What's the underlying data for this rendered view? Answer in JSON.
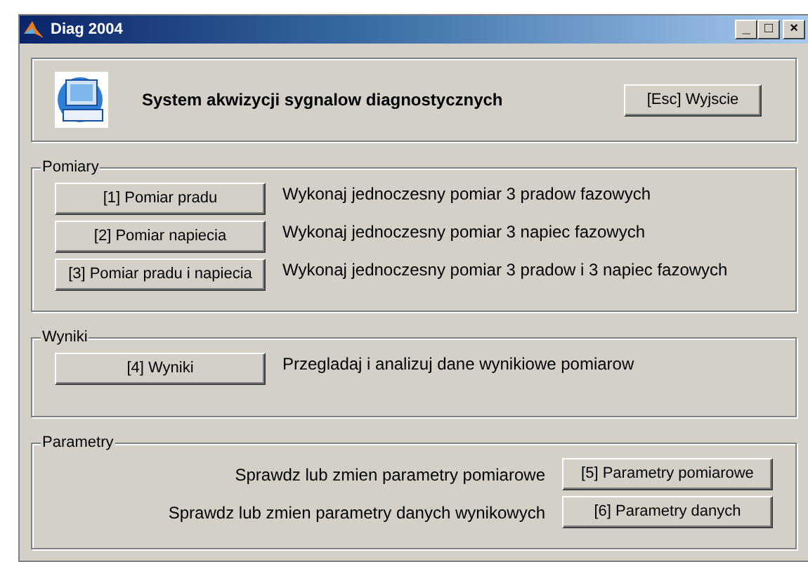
{
  "window": {
    "title": "Diag 2004",
    "controls": [
      "_",
      "□",
      "×"
    ]
  },
  "header": {
    "title": "System akwizycji sygnalow diagnostycznych",
    "exit_button": "[Esc] Wyjscie"
  },
  "groups": [
    {
      "title": "Pomiary",
      "kind": "standard",
      "rows": [
        {
          "button": "[1] Pomiar pradu",
          "description": "Wykonaj jednoczesny pomiar 3 pradow fazowych"
        },
        {
          "button": "[2] Pomiar napiecia",
          "description": "Wykonaj jednoczesny pomiar 3 napiec fazowych"
        },
        {
          "button": "[3] Pomiar pradu i napiecia",
          "description": "Wykonaj jednoczesny pomiar 3 pradow i 3 napiec fazowych"
        }
      ]
    },
    {
      "title": "Wyniki",
      "kind": "standard",
      "rows": [
        {
          "button": "[4] Wyniki",
          "description": "Przegladaj i analizuj dane wynikiowe pomiarow"
        }
      ]
    },
    {
      "title": "Parametry",
      "kind": "reversed",
      "rows": [
        {
          "button": "[5] Parametry pomiarowe",
          "description": "Sprawdz lub zmien parametry pomiarowe"
        },
        {
          "button": "[6] Parametry danych",
          "description": "Sprawdz lub zmien parametry danych wynikowych"
        }
      ]
    }
  ]
}
